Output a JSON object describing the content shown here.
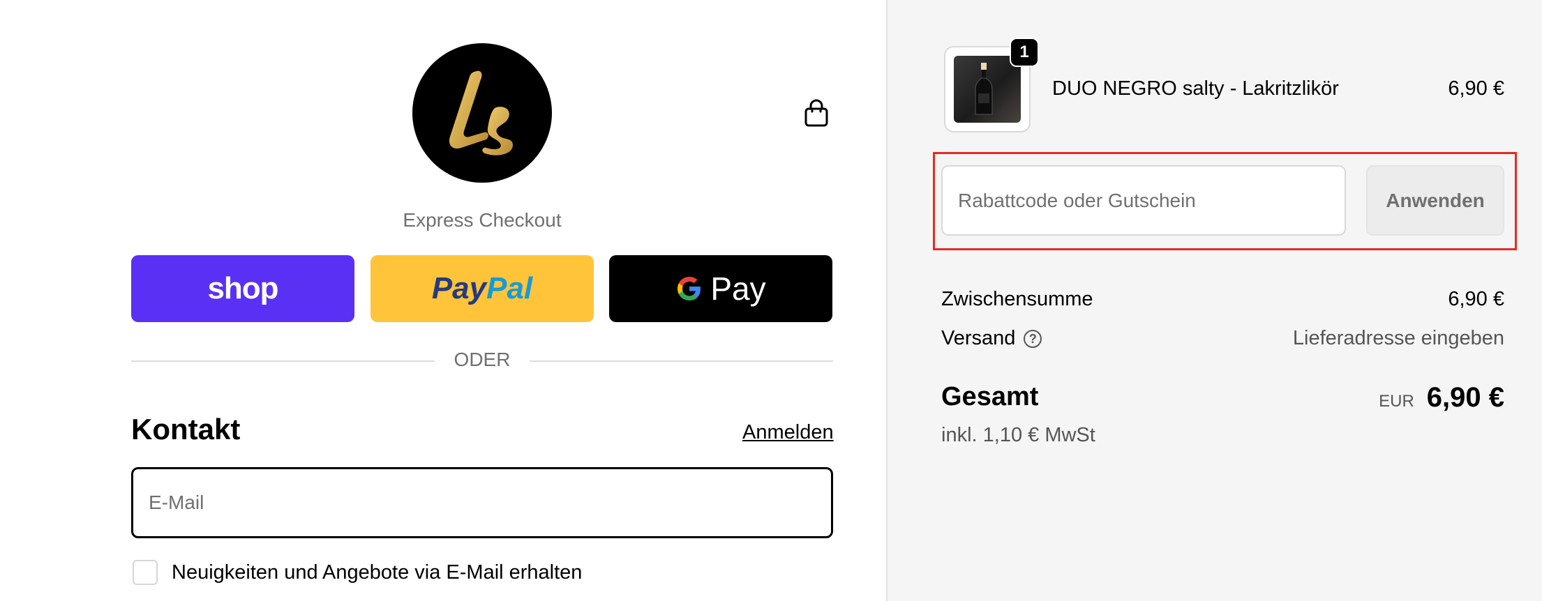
{
  "checkout": {
    "express_label": "Express Checkout",
    "shop_label": "shop",
    "paypal_part1": "Pay",
    "paypal_part2": "Pal",
    "gpay_g": "G",
    "gpay_label": "Pay",
    "divider_label": "ODER",
    "contact_title": "Kontakt",
    "login_link": "Anmelden",
    "email_placeholder": "E-Mail",
    "newsletter_label": "Neuigkeiten und Angebote via E-Mail erhalten"
  },
  "summary": {
    "product": {
      "quantity": "1",
      "name": "DUO NEGRO salty - Lakritzlikör",
      "price": "6,90 €"
    },
    "discount_placeholder": "Rabattcode oder Gutschein",
    "apply_label": "Anwenden",
    "subtotal_label": "Zwischensumme",
    "subtotal_value": "6,90 €",
    "shipping_label": "Versand",
    "shipping_help": "?",
    "shipping_value": "Lieferadresse eingeben",
    "total_label": "Gesamt",
    "currency": "EUR",
    "total_value": "6,90 €",
    "tax_note": "inkl. 1,10 € MwSt"
  },
  "colors": {
    "shop_pay": "#5a31f4",
    "paypal": "#ffc439",
    "gpay": "#000000",
    "highlight": "#e22d22",
    "logo_gold": "#d4a94a"
  }
}
